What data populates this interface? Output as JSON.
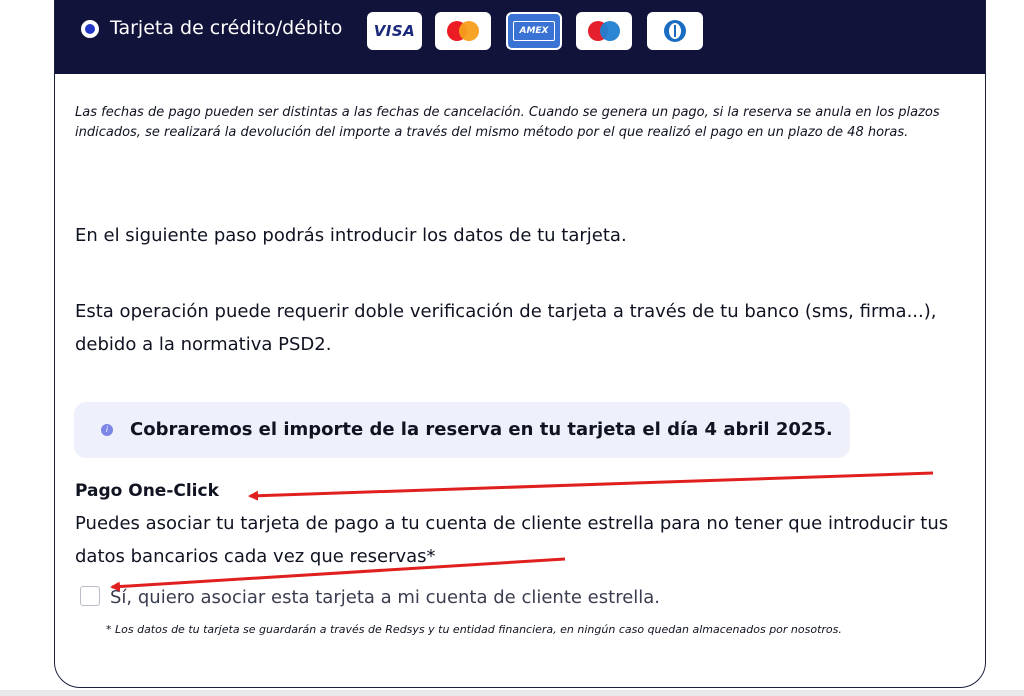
{
  "payment_option": {
    "label": "Tarjeta de crédito/débito",
    "logos": {
      "visa": "VISA",
      "mastercard": "mastercard-logo",
      "amex": "AMEX",
      "maestro": "maestro-logo",
      "diners": "diners-logo"
    }
  },
  "notice": "Las fechas de pago pueden ser distintas a las fechas de cancelación. Cuando se genera un pago, si la reserva se anula en los plazos indicados, se realizará la devolución del importe a través del mismo método por el que realizó el pago en un plazo de 48 horas.",
  "info": {
    "next_step": "En el siguiente paso podrás introducir los datos de tu tarjeta.",
    "verification": "Esta operación puede requerir doble verificación de tarjeta a través de tu banco (sms, firma...), debido a la normativa PSD2."
  },
  "charge_notice": "Cobraremos el importe de la reserva en tu tarjeta el día 4 abril 2025.",
  "one_click": {
    "title": "Pago One-Click",
    "description": "Puedes asociar tu tarjeta de pago a tu cuenta de cliente estrella para no tener que introducir tus datos bancarios cada vez que reservas*",
    "checkbox_label": "Sí, quiero asociar esta tarjeta a mi cuenta de cliente estrella.",
    "checkbox_checked": false,
    "footnote": "* Los datos de tu tarjeta se guardarán a través de Redsys y tu entidad financiera, en ningún caso quedan almacenados por nosotros."
  },
  "colors": {
    "header_bg": "#12133a",
    "accent": "#2438c6",
    "info_bg": "#eef0fb",
    "annotation_arrow": "#e0201e"
  }
}
